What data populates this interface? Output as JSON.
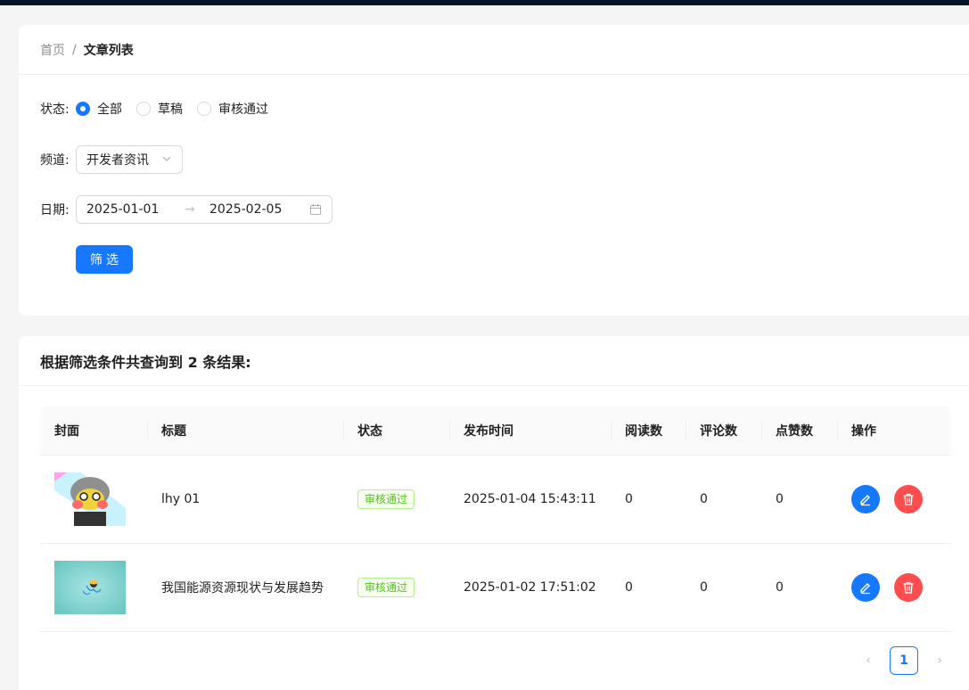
{
  "colors": {
    "primary": "#1677ff",
    "danger": "#ff4d4f",
    "success": "#52c41a",
    "topbar": "#001529"
  },
  "breadcrumb": {
    "home": "首页",
    "separator": "/",
    "current": "文章列表"
  },
  "filter": {
    "status_label": "状态:",
    "status_options": [
      {
        "label": "全部",
        "checked": true
      },
      {
        "label": "草稿",
        "checked": false
      },
      {
        "label": "审核通过",
        "checked": false
      }
    ],
    "channel_label": "频道:",
    "channel_value": "开发者资讯",
    "date_label": "日期:",
    "date_start": "2025-01-01",
    "date_arrow": "→",
    "date_end": "2025-02-05",
    "submit_label": "筛选"
  },
  "results": {
    "title": "根据筛选条件共查询到 2 条结果:",
    "columns": [
      "封面",
      "标题",
      "状态",
      "发布时间",
      "阅读数",
      "评论数",
      "点赞数",
      "操作"
    ],
    "rows": [
      {
        "cover": "cartoon-avatar-image",
        "title": "lhy 01",
        "status": "审核通过",
        "pubdate": "2025-01-04 15:43:11",
        "read": "0",
        "comment": "0",
        "like": "0"
      },
      {
        "cover": "teal-illustration-image",
        "title": "我国能源资源现状与发展趋势",
        "status": "审核通过",
        "pubdate": "2025-01-02 17:51:02",
        "read": "0",
        "comment": "0",
        "like": "0"
      }
    ]
  },
  "pagination": {
    "prev": "‹",
    "current": "1",
    "next": "›"
  }
}
